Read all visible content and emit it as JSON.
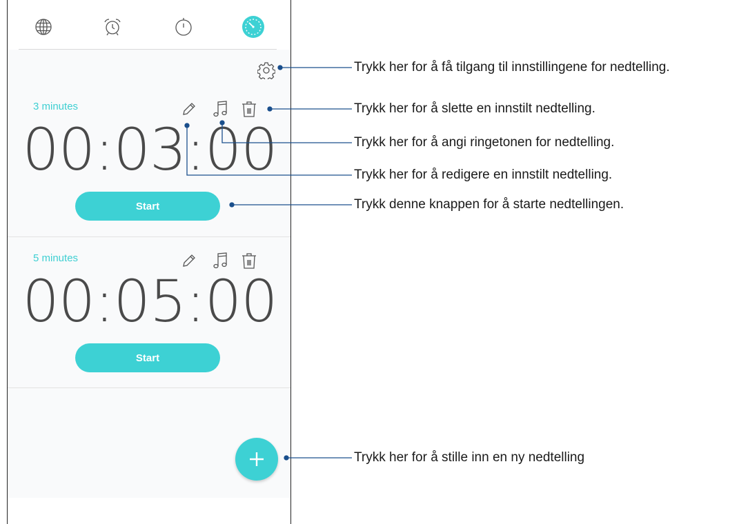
{
  "tabs": [
    {
      "icon": "globe-icon"
    },
    {
      "icon": "alarm-clock-icon"
    },
    {
      "icon": "stopwatch-icon"
    },
    {
      "icon": "timer-icon",
      "active": true
    }
  ],
  "timers": [
    {
      "label": "3 minutes",
      "time": "00:03:00",
      "start_label": "Start"
    },
    {
      "label": "5 minutes",
      "time": "00:05:00",
      "start_label": "Start"
    }
  ],
  "callouts": {
    "settings": "Trykk her for å få tilgang til innstillingene for nedtelling.",
    "delete": "Trykk her for å slette en innstilt nedtelling.",
    "ringtone": "Trykk her for å angi ringetonen for nedtelling.",
    "edit": "Trykk her for å redigere en innstilt nedtelling.",
    "start": "Trykk denne knappen for å starte nedtellingen.",
    "add": "Trykk her for å stille inn en ny nedtelling"
  },
  "colors": {
    "accent": "#3dd1d4",
    "callout_line": "#1a4f8c",
    "text_dark": "#4a4a4a"
  }
}
